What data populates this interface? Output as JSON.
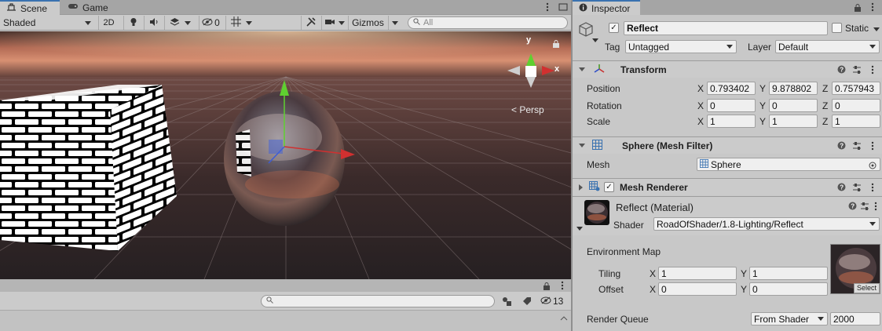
{
  "scene_tabs": {
    "scene": "Scene",
    "game": "Game"
  },
  "scene_toolbar": {
    "draw_mode": "Shaded",
    "mode_2d": "2D",
    "hidden_count": "0",
    "gizmos": "Gizmos",
    "search_placeholder": "All"
  },
  "viewport": {
    "persp_label": "< Persp",
    "axis_y": "y",
    "axis_x": "x"
  },
  "bottom_bar": {
    "search_placeholder": "",
    "hidden_count": "13"
  },
  "inspector": {
    "tab": "Inspector",
    "object": {
      "name": "Reflect",
      "static_label": "Static",
      "active": true,
      "static": false
    },
    "tag_label": "Tag",
    "tag_value": "Untagged",
    "layer_label": "Layer",
    "layer_value": "Default",
    "transform": {
      "title": "Transform",
      "position_label": "Position",
      "rotation_label": "Rotation",
      "scale_label": "Scale",
      "x": "X",
      "y": "Y",
      "z": "Z",
      "position": [
        "0.793402",
        "9.878802",
        "0.757943"
      ],
      "rotation": [
        "0",
        "0",
        "0"
      ],
      "scale": [
        "1",
        "1",
        "1"
      ]
    },
    "mesh_filter": {
      "title": "Sphere (Mesh Filter)",
      "mesh_label": "Mesh",
      "mesh_value": "Sphere"
    },
    "mesh_renderer": {
      "title": "Mesh Renderer",
      "enabled": true
    },
    "material": {
      "title": "Reflect (Material)",
      "shader_label": "Shader",
      "shader_value": "RoadOfShader/1.8-Lighting/Reflect",
      "env_map_label": "Environment Map",
      "tiling_label": "Tiling",
      "offset_label": "Offset",
      "tiling": [
        "1",
        "1"
      ],
      "offset": [
        "0",
        "0"
      ],
      "select_label": "Select",
      "render_queue_label": "Render Queue",
      "render_queue_mode": "From Shader",
      "render_queue_value": "2000"
    }
  },
  "colors": {
    "accent": "#3a72b0",
    "panel": "#c8c8c8",
    "header": "#cbcbcb"
  }
}
